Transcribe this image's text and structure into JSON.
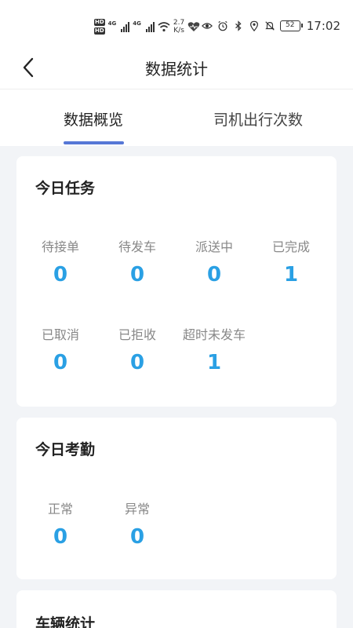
{
  "status_bar": {
    "hd_top": "HD",
    "hd_bottom": "HD",
    "net_1": "4G",
    "net_2": "4G",
    "speed_value": "2.7",
    "speed_unit": "K/s",
    "battery": "52",
    "time": "17:02"
  },
  "nav": {
    "title": "数据统计"
  },
  "tabs": [
    {
      "label": "数据概览",
      "active": true
    },
    {
      "label": "司机出行次数",
      "active": false
    }
  ],
  "task_card": {
    "title": "今日任务",
    "stats": [
      {
        "label": "待接单",
        "value": "0"
      },
      {
        "label": "待发车",
        "value": "0"
      },
      {
        "label": "派送中",
        "value": "0"
      },
      {
        "label": "已完成",
        "value": "1"
      },
      {
        "label": "已取消",
        "value": "0"
      },
      {
        "label": "已拒收",
        "value": "0"
      },
      {
        "label": "超时未发车",
        "value": "1"
      }
    ]
  },
  "attendance_card": {
    "title": "今日考勤",
    "stats": [
      {
        "label": "正常",
        "value": "0"
      },
      {
        "label": "异常",
        "value": "0"
      }
    ]
  },
  "vehicle_card": {
    "title": "车辆统计"
  },
  "colors": {
    "accent": "#5677d6",
    "value": "#2aa0e4",
    "background": "#f2f4f7"
  }
}
